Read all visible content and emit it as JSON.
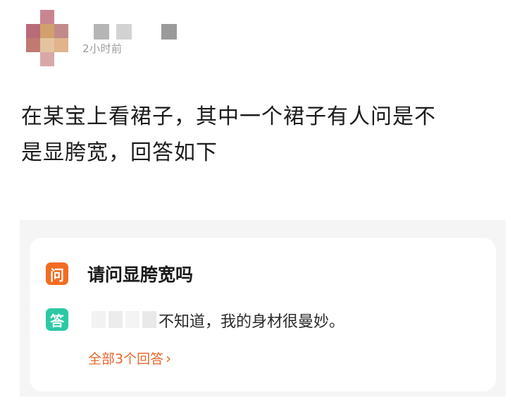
{
  "post": {
    "timestamp": "2小时前",
    "body_line1": "在某宝上看裙子，其中一个裙子有人问是不",
    "body_line2": "是显胯宽，回答如下"
  },
  "qa": {
    "question_badge": "问",
    "answer_badge": "答",
    "question": "请问显胯宽吗",
    "answer": "不知道，我的身材很曼妙。",
    "all_answers_label": "全部3个回答",
    "all_answers_chevron": "›"
  },
  "colors": {
    "question_badge": "#f36c21",
    "answer_badge": "#2cc9a4",
    "link": "#e8672a"
  }
}
